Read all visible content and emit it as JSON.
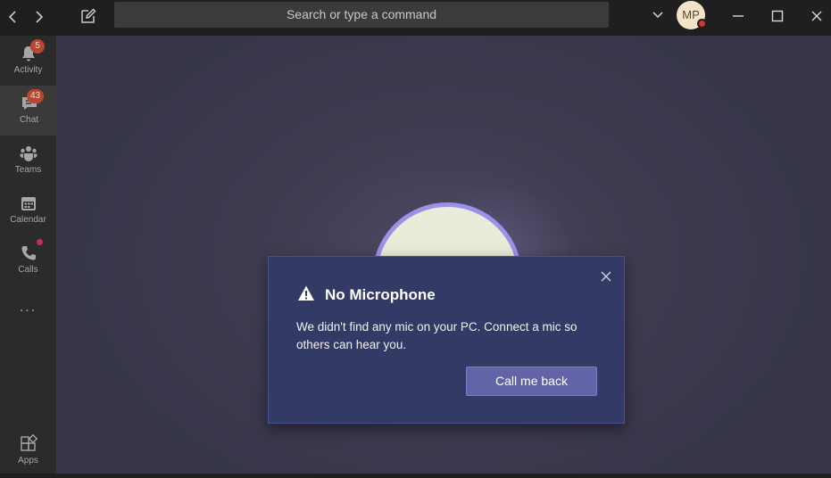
{
  "titlebar": {
    "search_placeholder": "Search or type a command",
    "avatar_initials": "MP",
    "presence_color": "#d13438"
  },
  "rail": {
    "items": [
      {
        "label": "Activity",
        "icon": "bell-icon",
        "badge": "5"
      },
      {
        "label": "Chat",
        "icon": "chat-icon",
        "badge": "43",
        "active": true
      },
      {
        "label": "Teams",
        "icon": "teams-icon"
      },
      {
        "label": "Calendar",
        "icon": "calendar-icon"
      },
      {
        "label": "Calls",
        "icon": "phone-icon",
        "dot": true
      }
    ],
    "more": "...",
    "apps_label": "Apps"
  },
  "dialog": {
    "title": "No Microphone",
    "body": "We didn't find any mic on your PC. Connect a mic so others can hear you.",
    "button_label": "Call me back"
  },
  "colors": {
    "accent": "#6264a7",
    "dialog_bg": "#333a66",
    "badge": "#b64832"
  }
}
